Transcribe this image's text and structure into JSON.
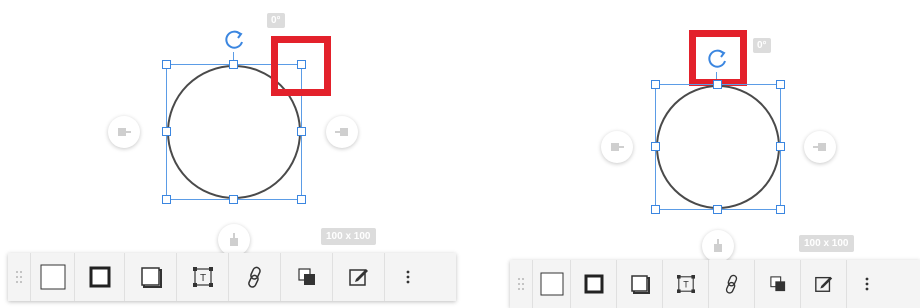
{
  "left_panel": {
    "angle_label": "0°",
    "dimension_label": "100 x 100"
  },
  "right_panel": {
    "angle_label": "0°",
    "dimension_label": "100 x 100"
  },
  "toolbar_tools": [
    {
      "name": "no-border-square-icon"
    },
    {
      "name": "thick-border-square-icon"
    },
    {
      "name": "shadow-square-icon"
    },
    {
      "name": "text-frame-icon"
    },
    {
      "name": "link-icon"
    },
    {
      "name": "layers-icon"
    },
    {
      "name": "edit-style-icon"
    },
    {
      "name": "more-options-icon"
    }
  ],
  "colors": {
    "highlight": "#e3212b",
    "selection": "#3b86e0",
    "shape_stroke": "#4a4a4a",
    "toolbar_bg": "#f4f4f4"
  }
}
